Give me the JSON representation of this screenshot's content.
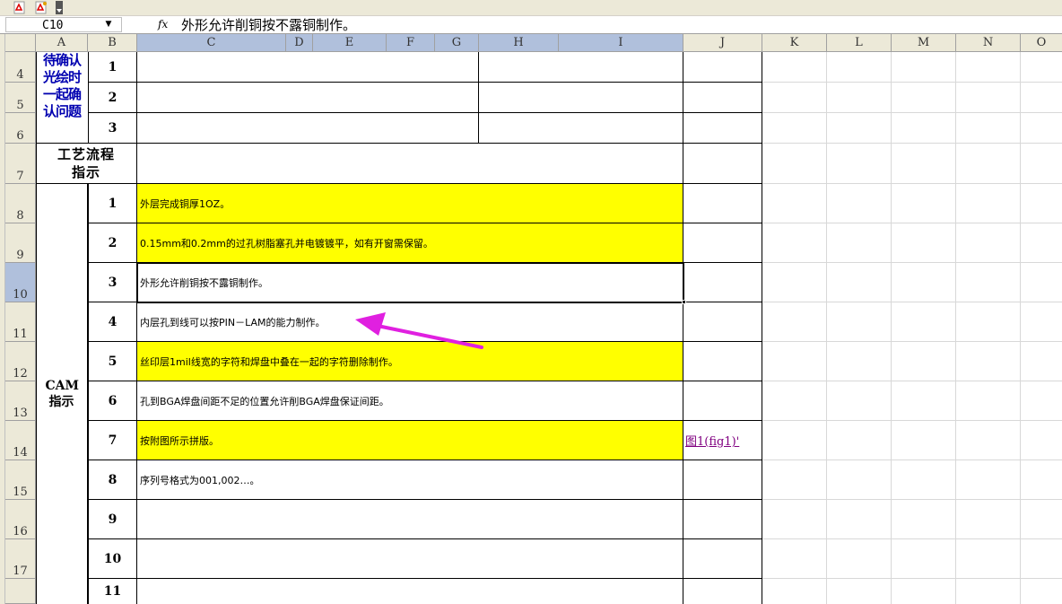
{
  "formula_bar": {
    "name_box": "C10",
    "fx_label": "fx",
    "formula": "外形允许削铜按不露铜制作。"
  },
  "columns": [
    "A",
    "B",
    "C",
    "D",
    "E",
    "F",
    "G",
    "H",
    "I",
    "J",
    "K",
    "L",
    "M",
    "N",
    "O"
  ],
  "rows": [
    "4",
    "5",
    "6",
    "7",
    "8",
    "9",
    "10",
    "11",
    "12",
    "13",
    "14",
    "15",
    "16",
    "17"
  ],
  "sections": {
    "confirm": "待确认光绘时一起确认问题",
    "process": "工艺流程指示",
    "cam": "CAM指示"
  },
  "confirm_items": [
    "1",
    "2",
    "3"
  ],
  "cam_items": [
    {
      "no": "1",
      "text": "外层完成铜厚1OZ。",
      "highlight": true
    },
    {
      "no": "2",
      "text": "0.15mm和0.2mm的过孔树脂塞孔并电镀镀平，如有开窗需保留。",
      "highlight": true
    },
    {
      "no": "3",
      "text": "外形允许削铜按不露铜制作。",
      "highlight": false
    },
    {
      "no": "4",
      "text": "内层孔到线可以按PIN－LAM的能力制作。",
      "highlight": false
    },
    {
      "no": "5",
      "text": "丝印层1mil线宽的字符和焊盘中叠在一起的字符删除制作。",
      "highlight": true
    },
    {
      "no": "6",
      "text": "孔到BGA焊盘间距不足的位置允许削BGA焊盘保证间距。",
      "highlight": false
    },
    {
      "no": "7",
      "text": "按附图所示拼版。",
      "highlight": true,
      "link": "图1(fig1)'"
    },
    {
      "no": "8",
      "text": "序列号格式为001,002…。",
      "highlight": false
    },
    {
      "no": "9",
      "text": "",
      "highlight": false
    },
    {
      "no": "10",
      "text": "",
      "highlight": false
    },
    {
      "no": "11",
      "text": "",
      "highlight": false
    }
  ],
  "colors": {
    "highlight": "#ffff00",
    "arrow": "#e020e0",
    "header_bg": "#ece9d8",
    "selected_header": "#b0c0dc",
    "link": "#800080"
  },
  "icons": [
    "pdf-icon",
    "pdf-export-icon",
    "toolbar-options-icon",
    "dropdown-arrow-icon",
    "magenta-arrow-annotation"
  ]
}
